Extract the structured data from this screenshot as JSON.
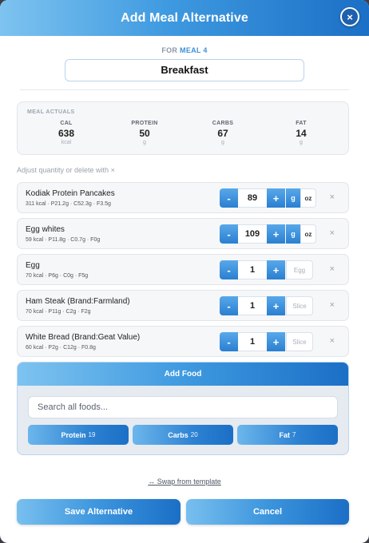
{
  "header": {
    "title": "Add Meal Alternative",
    "close_label": "×"
  },
  "meal": {
    "for_prefix": "FOR",
    "meal_ref": "MEAL 4",
    "name_value": "Breakfast"
  },
  "actuals": {
    "heading": "MEAL ACTUALS",
    "macros": [
      {
        "label": "CAL",
        "value": "638",
        "unit": "kcal"
      },
      {
        "label": "PROTEIN",
        "value": "50",
        "unit": "g"
      },
      {
        "label": "CARBS",
        "value": "67",
        "unit": "g"
      },
      {
        "label": "FAT",
        "value": "14",
        "unit": "g"
      }
    ]
  },
  "hint": "Adjust quantity or delete with ×",
  "items": [
    {
      "name": "Kodiak Protein Pancakes",
      "sub": "311 kcal · P21.2g · C52.3g · F3.5g",
      "qty": "89",
      "unit_mode": "g/oz",
      "unit_a": "g",
      "unit_b": "oz"
    },
    {
      "name": "Egg whites",
      "sub": "59 kcal · P11.8g · C0.7g · F0g",
      "qty": "109",
      "unit_mode": "g/oz",
      "unit_a": "g",
      "unit_b": "oz"
    },
    {
      "name": "Egg",
      "sub": "70 kcal · P6g · C0g · F5g",
      "qty": "1",
      "unit_mode": "static",
      "unit_a": "Egg"
    },
    {
      "name": "Ham Steak (Brand:Farmland)",
      "sub": "70 kcal · P11g · C2g · F2g",
      "qty": "1",
      "unit_mode": "static",
      "unit_a": "Slice"
    },
    {
      "name": "White Bread (Brand:Geat Value)",
      "sub": "60 kcal · P2g · C12g · F0.8g",
      "qty": "1",
      "unit_mode": "static",
      "unit_a": "Slice"
    }
  ],
  "controls": {
    "minus": "-",
    "plus": "+",
    "delete": "×"
  },
  "add_food": {
    "title": "Add Food",
    "search_placeholder": "Search all foods...",
    "chips": [
      {
        "label": "Protein",
        "count": "19"
      },
      {
        "label": "Carbs",
        "count": "20"
      },
      {
        "label": "Fat",
        "count": "7"
      }
    ]
  },
  "swap_link": "↔ Swap from template",
  "footer": {
    "save": "Save Alternative",
    "cancel": "Cancel"
  },
  "colors": {
    "accent": "#3d8fd8",
    "accent_dark": "#1b6fc6",
    "accent_light": "#7ec3f0"
  }
}
